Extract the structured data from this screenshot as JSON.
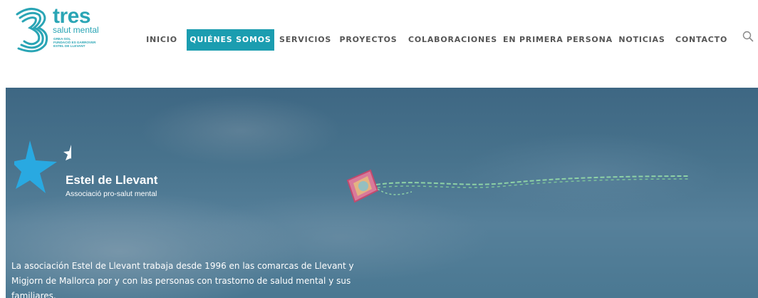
{
  "brand": {
    "name": "tres",
    "tagline": "salut mental",
    "small_lines": [
      "GREA-SOL",
      "FUNDACIÓ ES GARROVER",
      "ESTEL DE LLEVANT"
    ],
    "accent": "#1b9db0"
  },
  "nav": {
    "items": [
      {
        "label": "INICIO"
      },
      {
        "label": "QUIÉNES SOMOS",
        "active": true
      },
      {
        "label": "SERVICIOS"
      },
      {
        "label": "PROYECTOS"
      },
      {
        "label": "COLABORACIONES"
      },
      {
        "label": "EN PRIMERA PERSONA"
      },
      {
        "label": "NOTICIAS"
      },
      {
        "label": "CONTACTO"
      }
    ],
    "search_icon": "search-icon"
  },
  "hero": {
    "org_name": "Estel de Llevant",
    "org_subtitle": "Associació pro-salut mental",
    "description": "La asociación Estel de Llevant trabaja desde 1996 en las comarcas de Llevant y Migjorn de Mallorca por y con las personas con trastorno de salud mental y sus familiares."
  }
}
